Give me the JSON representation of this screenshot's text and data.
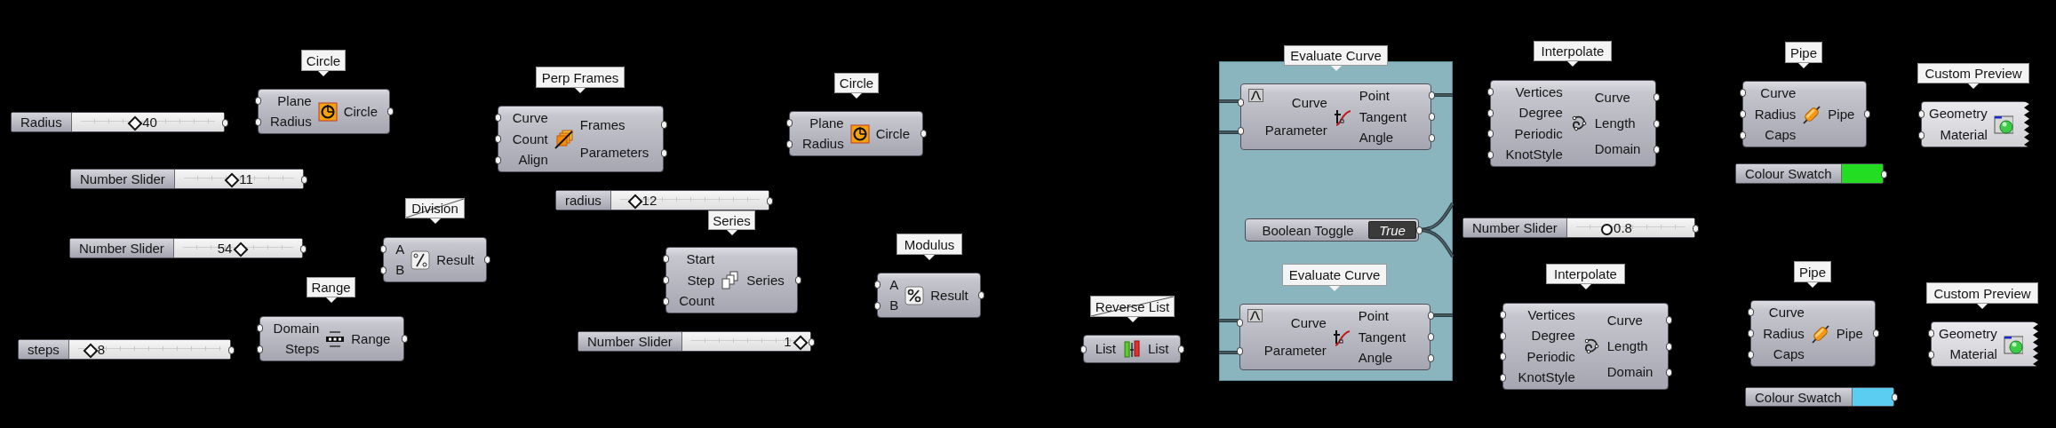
{
  "canvas": {
    "components": [
      {
        "name": "Circle",
        "struck": false,
        "inputs": [
          "Plane",
          "Radius"
        ],
        "outputs": [
          "Circle"
        ]
      },
      {
        "name": "Range",
        "struck": false,
        "inputs": [
          "Domain",
          "Steps"
        ],
        "outputs": [
          "Range"
        ]
      },
      {
        "name": "Perp Frames",
        "struck": false,
        "inputs": [
          "Curve",
          "Count",
          "Align"
        ],
        "outputs": [
          "Frames",
          "Parameters"
        ]
      },
      {
        "name": "Division",
        "struck": true,
        "inputs": [
          "A",
          "B"
        ],
        "outputs": [
          "Result"
        ]
      },
      {
        "name": "Series",
        "struck": false,
        "inputs": [
          "Start",
          "Step",
          "Count"
        ],
        "outputs": [
          "Series"
        ]
      },
      {
        "name": "Circle",
        "struck": false,
        "inputs": [
          "Plane",
          "Radius"
        ],
        "outputs": [
          "Circle"
        ]
      },
      {
        "name": "Modulus",
        "struck": false,
        "inputs": [
          "A",
          "B"
        ],
        "outputs": [
          "Result"
        ]
      },
      {
        "name": "Reverse List",
        "struck": true,
        "inputs": [
          "List"
        ],
        "outputs": [
          "List"
        ]
      },
      {
        "name": "Evaluate Curve",
        "struck": false,
        "inputs": [
          "Curve",
          "Parameter"
        ],
        "outputs": [
          "Point",
          "Tangent",
          "Angle"
        ]
      },
      {
        "name": "Evaluate Curve",
        "struck": false,
        "inputs": [
          "Curve",
          "Parameter"
        ],
        "outputs": [
          "Point",
          "Tangent",
          "Angle"
        ]
      },
      {
        "name": "Interpolate",
        "struck": false,
        "inputs": [
          "Vertices",
          "Degree",
          "Periodic",
          "KnotStyle"
        ],
        "outputs": [
          "Curve",
          "Length",
          "Domain"
        ]
      },
      {
        "name": "Interpolate",
        "struck": false,
        "inputs": [
          "Vertices",
          "Degree",
          "Periodic",
          "KnotStyle"
        ],
        "outputs": [
          "Curve",
          "Length",
          "Domain"
        ]
      },
      {
        "name": "Pipe",
        "struck": false,
        "inputs": [
          "Curve",
          "Radius",
          "Caps"
        ],
        "outputs": [
          "Pipe"
        ]
      },
      {
        "name": "Pipe",
        "struck": false,
        "inputs": [
          "Curve",
          "Radius",
          "Caps"
        ],
        "outputs": [
          "Pipe"
        ]
      },
      {
        "name": "Custom Preview",
        "struck": false,
        "inputs": [
          "Geometry",
          "Material"
        ]
      },
      {
        "name": "Custom Preview",
        "struck": false,
        "inputs": [
          "Geometry",
          "Material"
        ]
      }
    ],
    "sliders": [
      {
        "label": "Radius",
        "value": "40",
        "level": 0.4
      },
      {
        "label": "Number Slider",
        "value": "11",
        "level": 0.43
      },
      {
        "label": "Number Slider",
        "value": "54",
        "level": 0.52
      },
      {
        "label": "steps",
        "value": "8",
        "level": 0.08
      },
      {
        "label": "radius",
        "value": "12",
        "level": 0.1
      },
      {
        "label": "Number Slider",
        "value": "1",
        "level": 0.98
      },
      {
        "label": "Number Slider",
        "value": "0.8",
        "level": 0.27
      }
    ],
    "toggles": [
      {
        "label": "Boolean Toggle",
        "value": "True",
        "on": true
      }
    ],
    "swatches": [
      {
        "label": "Colour Swatch",
        "color": "#22dd22"
      },
      {
        "label": "Colour Swatch",
        "color": "#5bcdf0"
      }
    ]
  }
}
